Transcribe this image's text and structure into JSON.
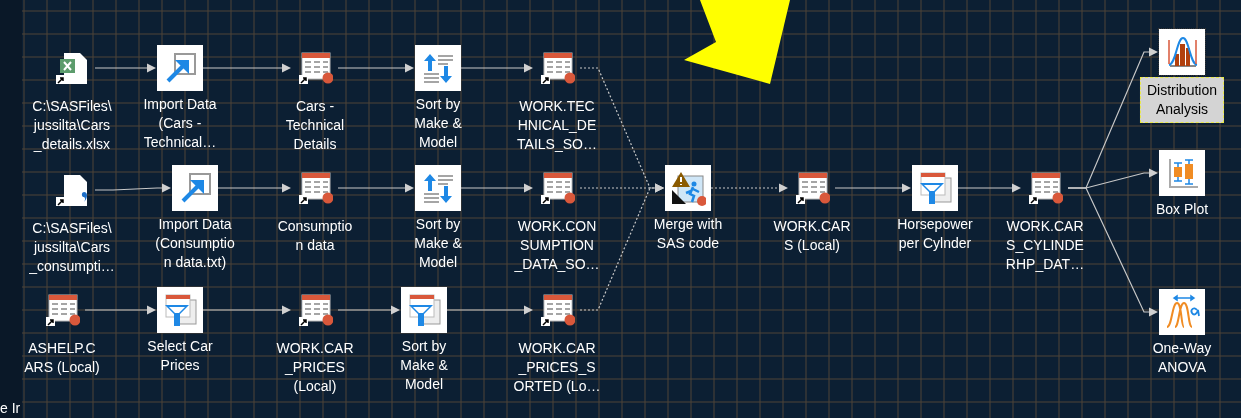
{
  "sidebar_text": "e Ir",
  "nodes": [
    {
      "kind": "excel",
      "label": "C:\\SASFiles\\\njussilta\\Cars\n_details.xlsx",
      "selected": false,
      "output_dashed": false
    },
    {
      "kind": "import",
      "label": "Import Data\n(Cars -\nTechnical…",
      "selected": false,
      "output_dashed": false
    },
    {
      "kind": "table",
      "label": "Cars -\nTechnical\nDetails",
      "selected": false,
      "output_dashed": false
    },
    {
      "kind": "sort",
      "label": "Sort by\nMake &\nModel",
      "selected": false,
      "output_dashed": false
    },
    {
      "kind": "table",
      "label": "WORK.TEC\nHNICAL_DE\nTAILS_SO…",
      "selected": false,
      "output_dashed": true
    },
    {
      "kind": "distribution",
      "label": "Distribution\nAnalysis",
      "selected": true
    },
    {
      "kind": "textfile",
      "label": "C:\\SASFiles\\\njussilta\\Cars\n_consumpti…",
      "selected": false,
      "output_dashed": false
    },
    {
      "kind": "import",
      "label": "Import Data\n(Consumptio\nn data.txt)",
      "selected": false,
      "output_dashed": false
    },
    {
      "kind": "table",
      "label": "Consumptio\nn data",
      "selected": false,
      "output_dashed": false
    },
    {
      "kind": "sort",
      "label": "Sort by\nMake &\nModel",
      "selected": false,
      "output_dashed": false
    },
    {
      "kind": "table",
      "label": "WORK.CON\nSUMPTION\n_DATA_SO…",
      "selected": false,
      "output_dashed": true
    },
    {
      "kind": "sascode",
      "label": "Merge with\nSAS code",
      "selected": false,
      "output_dashed": true
    },
    {
      "kind": "table",
      "label": "WORK.CAR\nS (Local)",
      "selected": false,
      "output_dashed": false
    },
    {
      "kind": "filter",
      "label": "Horsepower\nper Cylnder",
      "selected": false,
      "output_dashed": false
    },
    {
      "kind": "table",
      "label": "WORK.CAR\nS_CYLINDE\nRHP_DAT…",
      "selected": false,
      "output_dashed": false
    },
    {
      "kind": "boxplot",
      "label": "Box Plot",
      "selected": false
    },
    {
      "kind": "table",
      "label": "ASHELP.C\nARS (Local)",
      "selected": false,
      "output_dashed": false
    },
    {
      "kind": "filter",
      "label": "Select Car\nPrices",
      "selected": false,
      "output_dashed": false
    },
    {
      "kind": "table",
      "label": "WORK.CAR\n_PRICES\n(Local)",
      "selected": false,
      "output_dashed": false
    },
    {
      "kind": "filter",
      "label": "Sort by\nMake &\nModel",
      "selected": false,
      "output_dashed": false
    },
    {
      "kind": "table",
      "label": "WORK.CAR\n_PRICES_S\nORTED (Lo…",
      "selected": false,
      "output_dashed": true
    },
    {
      "kind": "anova",
      "label": "One-Way\nANOVA",
      "selected": false
    }
  ]
}
